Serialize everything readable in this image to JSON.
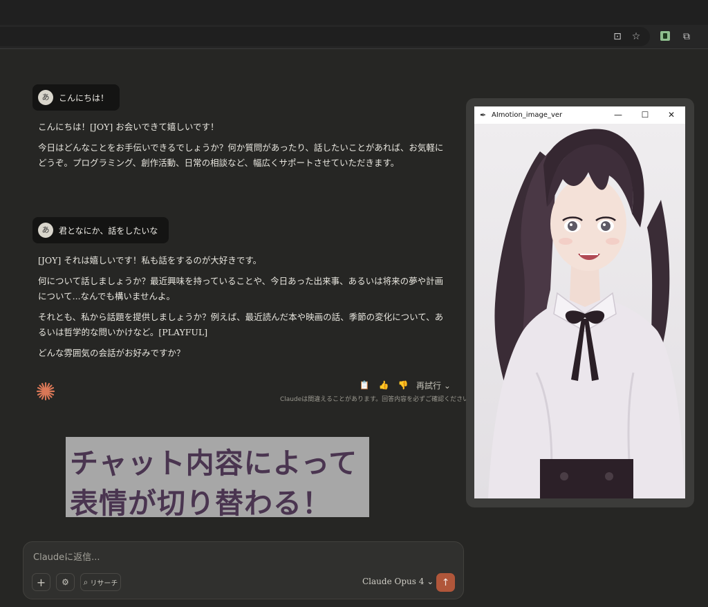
{
  "browser": {
    "toolbar_icons": [
      "install-app-icon",
      "bookmark-star-icon",
      "extension-icon",
      "puzzle-icon"
    ],
    "install_glyph": "⊡",
    "star_glyph": "☆",
    "puzzle_glyph": "⧉"
  },
  "chat": {
    "messages": [
      {
        "avatar": "あ",
        "user_text": "こんにちは！",
        "reply": [
          "こんにちは！[JOY] お会いできて嬉しいです！",
          "今日はどんなことをお手伝いできるでしょうか？何か質問があったり、話したいことがあれば、お気軽にどうぞ。プログラミング、創作活動、日常の相談など、幅広くサポートさせていただきます。"
        ]
      },
      {
        "avatar": "あ",
        "user_text": "君となにか、話をしたいな",
        "reply": [
          "[JOY] それは嬉しいです！私も話をするのが大好きです。",
          "何について話しましょうか？最近興味を持っていることや、今日あった出来事、あるいは将来の夢や計画について...なんでも構いませんよ。",
          "それとも、私から話題を提供しましょうか？例えば、最近読んだ本や映画の話、季節の変化について、あるいは哲学的な問いかけなど。[PLAYFUL]",
          "どんな雰囲気の会話がお好みですか？"
        ]
      }
    ],
    "actions": {
      "copy_glyph": "📋",
      "like_glyph": "👍",
      "dislike_glyph": "👎",
      "retry_label": "再試行",
      "retry_chevron": "⌄"
    },
    "disclaimer": "Claudeは間違えることがあります。回答内容を必ずご確認ください。"
  },
  "overlay": {
    "line1": "チャット内容によって",
    "line2": "表情が切り替わる！"
  },
  "composer": {
    "placeholder": "Claudeに返信...",
    "plus_glyph": "+",
    "tools_glyph": "⚙",
    "research_glyph": "⌕",
    "research_label": "リサーチ",
    "model_label": "Claude Opus 4",
    "model_chevron": "⌄",
    "send_glyph": "↑"
  },
  "app_window": {
    "title": "AImotion_image_ver",
    "feather_glyph": "✒",
    "minimize_glyph": "—",
    "maximize_glyph": "☐",
    "close_glyph": "✕"
  },
  "colors": {
    "background": "#262624",
    "accent": "#d97757",
    "send_button": "#b0563a",
    "caption_bg": "#a7a7a7",
    "caption_text": "#4a3550"
  }
}
